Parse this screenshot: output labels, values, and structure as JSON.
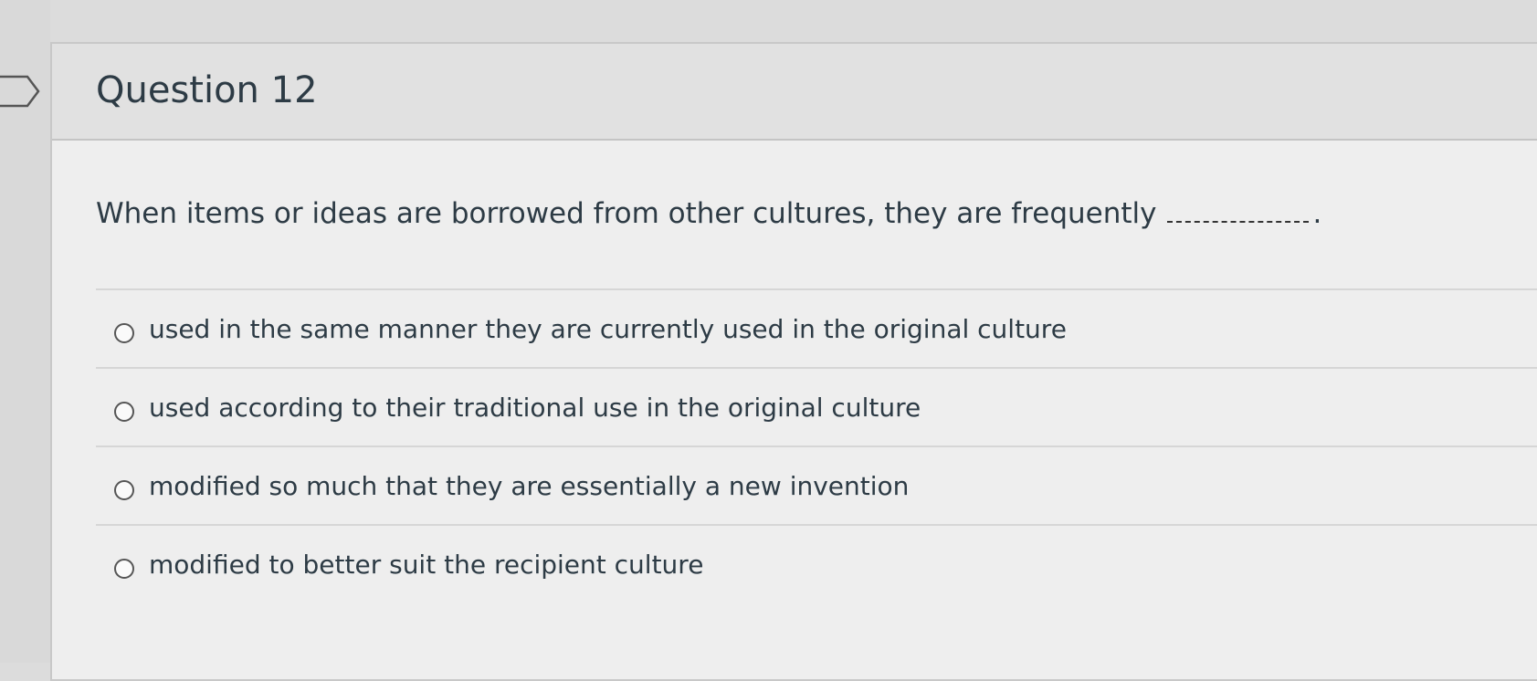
{
  "question": {
    "title": "Question 12",
    "text": "When items or ideas are borrowed from other cultures, they are frequently",
    "punctuation": "."
  },
  "answers": [
    {
      "label": "used in the same manner they are currently used in the original culture"
    },
    {
      "label": "used according to their traditional use in the original culture"
    },
    {
      "label": "modified so much that they are essentially a new invention"
    },
    {
      "label": "modified to better suit the recipient culture"
    }
  ],
  "icons": {
    "flag": "flag-outline-icon"
  }
}
